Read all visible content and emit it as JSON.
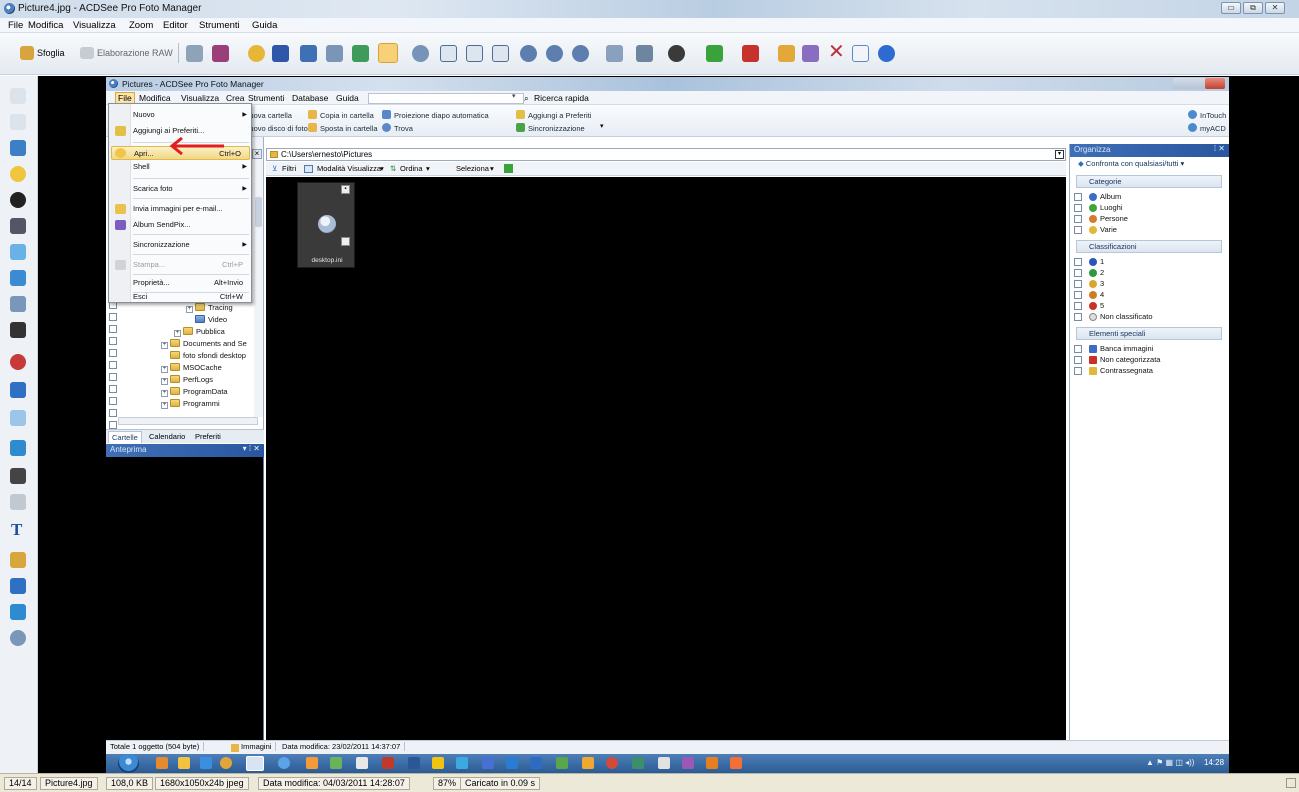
{
  "outer": {
    "title": "Picture4.jpg - ACDSee Pro Foto Manager",
    "window_buttons": [
      "▭",
      "⧉",
      "✕"
    ],
    "menu": [
      "File",
      "Modifica",
      "Visualizza",
      "Zoom",
      "Editor",
      "Strumenti",
      "Guida"
    ],
    "toolbar": {
      "browse_label": "Sfoglia",
      "raw_label": "Elaborazione RAW"
    }
  },
  "inner": {
    "title": "Pictures - ACDSee Pro Foto Manager",
    "menu": [
      "File",
      "Modifica",
      "Visualizza",
      "Crea",
      "Strumenti",
      "Database",
      "Guida"
    ],
    "quick_search": "Ricerca rapida",
    "toolbar": {
      "row1": [
        "Nuova cartella",
        "Copia in cartella",
        "Proiezione diapo automatica",
        "Aggiungi a Preferiti"
      ],
      "row2": [
        "Nuovo disco di foto",
        "Sposta in cartella",
        "Trova",
        "Sincronizzazione"
      ],
      "right1": "InTouch",
      "right2": "myACD"
    },
    "path": "C:\\Users\\ernesto\\Pictures",
    "filter_bar": {
      "filters": "Filtri",
      "view_mode": "Modalità Visualizza",
      "sort": "Ordina",
      "select": "Seleziona"
    },
    "folder_tree": [
      {
        "label": "Tracing",
        "indent": 5
      },
      {
        "label": "Video",
        "indent": 5
      },
      {
        "label": "Pubblica",
        "indent": 4
      },
      {
        "label": "Documents and Se",
        "indent": 3
      },
      {
        "label": "foto sfondi desktop",
        "indent": 3
      },
      {
        "label": "MSOCache",
        "indent": 3
      },
      {
        "label": "PerfLogs",
        "indent": 3
      },
      {
        "label": "ProgramData",
        "indent": 3
      },
      {
        "label": "Programmi",
        "indent": 3
      }
    ],
    "folder_tabs": [
      "Cartelle",
      "Calendario",
      "Preferiti"
    ],
    "preview_title": "Anteprima",
    "panel_controls": "▾ ⁞ ✕",
    "thumbnail": {
      "name": "desktop.ini"
    },
    "organize": {
      "title": "Organizza",
      "compare": "Confronta con qualsiasi/tutti",
      "sections": {
        "categories": "Categorie",
        "ratings": "Classificazioni",
        "special": "Elementi speciali"
      },
      "categories": [
        {
          "label": "Album",
          "color": "#3d6cc7"
        },
        {
          "label": "Luoghi",
          "color": "#3fa43b"
        },
        {
          "label": "Persone",
          "color": "#d77a2a"
        },
        {
          "label": "Varie",
          "color": "#e0b83a"
        }
      ],
      "ratings": [
        {
          "label": "1",
          "color": "#2e56b8"
        },
        {
          "label": "2",
          "color": "#2f9a3a"
        },
        {
          "label": "3",
          "color": "#d7a82c"
        },
        {
          "label": "4",
          "color": "#d07d22"
        },
        {
          "label": "5",
          "color": "#c9302a"
        },
        {
          "label": "Non classificato",
          "color": "#dddddd"
        }
      ],
      "special": [
        {
          "label": "Banca immagini",
          "color": "#3d6cc7"
        },
        {
          "label": "Non categorizzata",
          "color": "#c9302a"
        },
        {
          "label": "Contrassegnata",
          "color": "#e0b83a"
        }
      ]
    },
    "status": {
      "total": "Totale 1 oggetto (504 byte)",
      "type": "Immagini",
      "modified": "Data modifica: 23/02/2011 14:37:07"
    },
    "clock": "14:28"
  },
  "file_menu": {
    "items": [
      {
        "label": "Nuovo",
        "shortcut": "",
        "submenu": true,
        "disabled": false,
        "highlight": false
      },
      {
        "label": "Aggiungi ai Preferiti...",
        "shortcut": "",
        "submenu": false,
        "disabled": false,
        "highlight": false
      },
      {
        "label": "Apri...",
        "shortcut": "Ctrl+O",
        "submenu": false,
        "disabled": false,
        "highlight": true
      },
      {
        "label": "Shell",
        "shortcut": "",
        "submenu": true,
        "disabled": false,
        "highlight": false
      },
      {
        "label": "Scarica foto",
        "shortcut": "",
        "submenu": true,
        "disabled": false,
        "highlight": false
      },
      {
        "label": "Invia immagini per e-mail...",
        "shortcut": "",
        "submenu": false,
        "disabled": false,
        "highlight": false
      },
      {
        "label": "Album SendPix...",
        "shortcut": "",
        "submenu": false,
        "disabled": false,
        "highlight": false
      },
      {
        "label": "Sincronizzazione",
        "shortcut": "",
        "submenu": true,
        "disabled": false,
        "highlight": false
      },
      {
        "label": "Stampa...",
        "shortcut": "Ctrl+P",
        "submenu": false,
        "disabled": true,
        "highlight": false
      },
      {
        "label": "Proprietà...",
        "shortcut": "Alt+Invio",
        "submenu": false,
        "disabled": false,
        "highlight": false
      },
      {
        "label": "Esci",
        "shortcut": "Ctrl+W",
        "submenu": false,
        "disabled": false,
        "highlight": false
      }
    ]
  },
  "statusbar": {
    "index": "14/14",
    "file": "Picture4.jpg",
    "size": "108,0 KB",
    "dims": "1680x1050x24b jpeg",
    "modified": "Data modifica: 04/03/2011 14:28:07",
    "zoom": "87%",
    "load": "Caricato in 0.09 s"
  },
  "colors": {
    "accent": "#2857a0",
    "highlight": "#f2d784",
    "arrow": "#e02020"
  }
}
